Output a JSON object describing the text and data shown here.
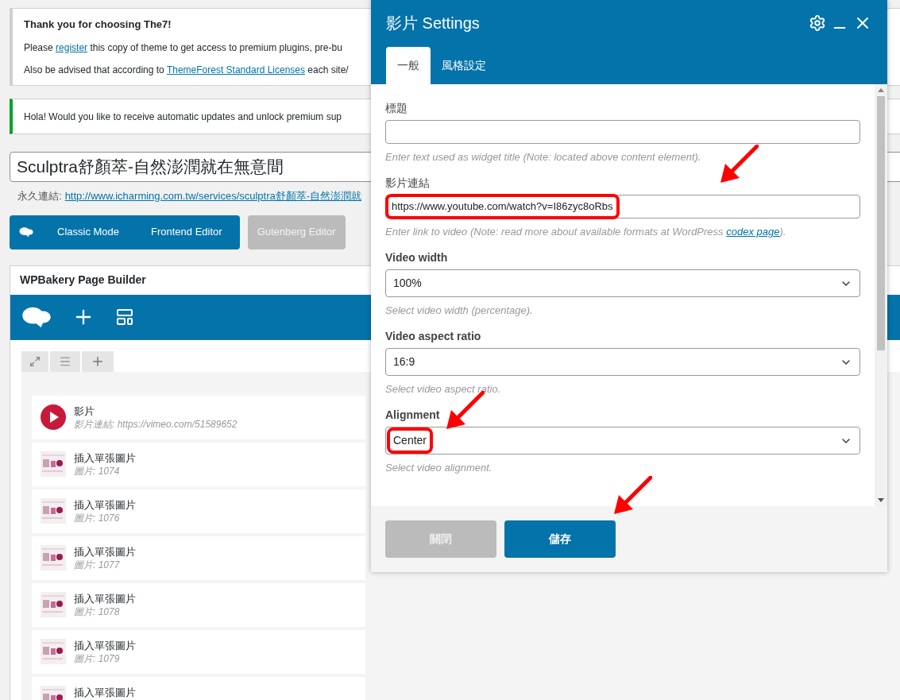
{
  "notices": [
    {
      "kind": "theme",
      "title": "Thank you for choosing The7!",
      "lines": [
        {
          "before": "Please ",
          "link": "register",
          "after": " this copy of theme to get access to premium plugins, pre-bu"
        },
        {
          "before": "Also be advised that according to ",
          "link": "ThemeForest Standard Licenses",
          "after": " each site/"
        }
      ]
    },
    {
      "kind": "success",
      "text": "Hola! Would you like to receive automatic updates and unlock premium sup"
    }
  ],
  "post_title": "Sculptra舒顏萃-自然澎潤就在無意間",
  "permalink": {
    "label": "永久連結:",
    "url": "http://www.icharming.com.tw/services/sculptra舒顏萃-自然澎潤就"
  },
  "editor_buttons": [
    {
      "label": "Classic Mode",
      "disabled": false
    },
    {
      "label": "Frontend Editor",
      "disabled": false
    },
    {
      "label": "Gutenberg Editor",
      "disabled": true
    }
  ],
  "builder": {
    "title": "WPBakery Page Builder",
    "elements": [
      {
        "kind": "video",
        "title": "影片",
        "subtitle": "影片連結: https://vimeo.com/51589652"
      },
      {
        "title": "插入單張圖片",
        "subtitle": "圖片: 1074"
      },
      {
        "title": "插入單張圖片",
        "subtitle": "圖片: 1076"
      },
      {
        "title": "插入單張圖片",
        "subtitle": "圖片: 1077"
      },
      {
        "title": "插入單張圖片",
        "subtitle": "圖片: 1078"
      },
      {
        "title": "插入單張圖片",
        "subtitle": "圖片: 1079"
      },
      {
        "title": "插入單張圖片"
      }
    ]
  },
  "dialog": {
    "title": "影片 Settings",
    "tabs": [
      {
        "label": "一般",
        "selected": true
      },
      {
        "label": "風格設定",
        "selected": false
      }
    ],
    "fields": [
      {
        "kind": "text",
        "label": "標題",
        "help": {
          "before": "Enter text used as widget title (Note: located above content element)."
        },
        "arrow": false,
        "outlined": false
      },
      {
        "kind": "text",
        "label": "影片連結",
        "value": "https://www.youtube.com/watch?v=I86zyc8oRbs",
        "help": {
          "before": "Enter link to video (Note: read more about available formats at WordPress ",
          "link": "codex page",
          "after": ")."
        },
        "arrow": true,
        "outlined": true
      },
      {
        "kind": "select",
        "label": "Video width",
        "value": "100%",
        "help": {
          "before": "Select video width (percentage)."
        },
        "arrow": false,
        "outlined": false
      },
      {
        "kind": "select",
        "label": "Video aspect ratio",
        "value": "16:9",
        "help": {
          "before": "Select video aspect ratio."
        },
        "arrow": false,
        "outlined": false
      },
      {
        "kind": "select",
        "label": "Alignment",
        "value": "Center",
        "help": {
          "before": "Select video alignment."
        },
        "arrow": true,
        "outlined": true
      }
    ],
    "buttons": [
      {
        "kind": "close",
        "label": "關閉",
        "arrow": false
      },
      {
        "kind": "save",
        "label": "儲存",
        "arrow": true
      }
    ]
  }
}
